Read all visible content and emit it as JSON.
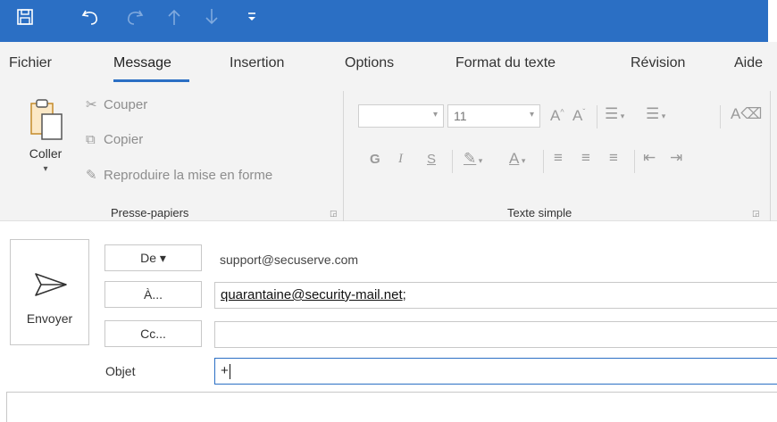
{
  "quick_access": {
    "save_icon": "save-icon",
    "undo_icon": "undo-icon",
    "redo_icon": "redo-icon",
    "up_icon": "arrow-up-icon",
    "down_icon": "arrow-down-icon",
    "customize_icon": "customize-qat-icon"
  },
  "tabs": [
    {
      "label": "Fichier"
    },
    {
      "label": "Message",
      "active": true
    },
    {
      "label": "Insertion"
    },
    {
      "label": "Options"
    },
    {
      "label": "Format du texte"
    },
    {
      "label": "Révision"
    },
    {
      "label": "Aide"
    }
  ],
  "ribbon": {
    "clipboard": {
      "paste_label": "Coller",
      "cut_label": "Couper",
      "copy_label": "Copier",
      "format_painter_label": "Reproduire la mise en forme",
      "group_label": "Presse-papiers"
    },
    "basic_text": {
      "font_name": "",
      "font_size": "11",
      "bold": "G",
      "italic": "I",
      "underline": "S",
      "group_label": "Texte simple"
    }
  },
  "message": {
    "send_label": "Envoyer",
    "from_button": "De ▾",
    "from_value": "support@secuserve.com",
    "to_button": "À...",
    "to_value": "quarantaine@security-mail.net",
    "to_suffix": ";",
    "cc_button": "Cc...",
    "cc_value": "",
    "subject_label": "Objet",
    "subject_value": "+"
  },
  "colors": {
    "title_bar": "#2b6fc4",
    "ribbon_bg": "#f3f3f3",
    "accent": "#2b6fc4"
  }
}
